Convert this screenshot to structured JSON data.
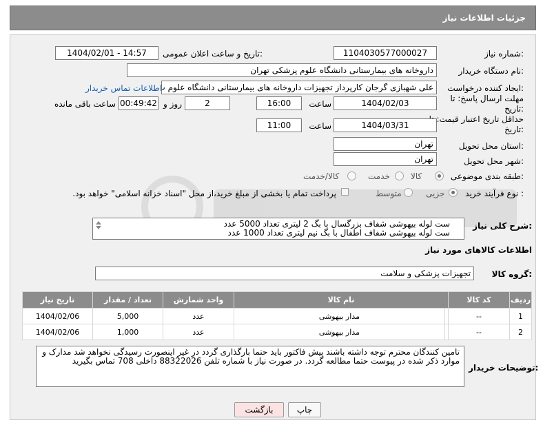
{
  "header": {
    "title": "جزئیات اطلاعات نیاز"
  },
  "fields": {
    "need_number_label": "شماره نیاز:",
    "need_number": "1104030577000027",
    "announce_label": "تاریخ و ساعت اعلان عمومی:",
    "announce_value": "1404/02/01 - 14:57",
    "buyer_org_label": "نام دستگاه خریدار:",
    "buyer_org": "داروخانه های بیمارستانی دانشگاه علوم پزشکی تهران",
    "creator_label": "ایجاد کننده درخواست:",
    "creator": "علی شهبازی گرجان کارپرداز تجهیزات داروخانه های بیمارستانی دانشگاه علوم پ",
    "contact_link": "اطلاعات تماس خریدار",
    "reply_deadline_label": "مهلت ارسال پاسخ: تا تاریخ:",
    "reply_date": "1404/02/03",
    "time_label": "ساعت",
    "reply_time": "16:00",
    "days_value": "2",
    "days_label": "روز و",
    "remaining_value": "00:49:42",
    "remaining_label": "ساعت باقی مانده",
    "price_validity_label": "حداقل تاریخ اعتبار قیمت: تا تاریخ:",
    "validity_date": "1404/03/31",
    "validity_time": "11:00",
    "province_label": "استان محل تحویل:",
    "province": "تهران",
    "city_label": "شهر محل تحویل:",
    "city": "تهران",
    "category_label": "طبقه بندی موضوعی:",
    "category_options": [
      "کالا",
      "خدمت",
      "کالا/خدمت"
    ],
    "process_label": "نوع فرآیند خرید :",
    "process_options": [
      "جزیی",
      "متوسط"
    ],
    "payment_note": "پرداخت تمام یا بخشی از مبلغ خرید،از محل \"اسناد خزانه اسلامی\" خواهد بود."
  },
  "description": {
    "label": "شرح کلی نیاز:",
    "lines": [
      "ست لوله بیهوشی شفاف بزرگسال با بگ 2 لیتری تعداد 5000 عدد",
      "ست لوله بیهوشی شفاف اطفال با بگ نیم لیتری تعداد 1000 عدد"
    ]
  },
  "goods": {
    "section_title": "اطلاعات کالاهای مورد نیاز",
    "group_label": "گروه کالا:",
    "group_value": "تجهیزات پزشکی و سلامت",
    "columns": [
      "ردیف",
      "کد کالا",
      "نام کالا",
      "واحد شمارش",
      "تعداد / مقدار",
      "تاریخ نیاز"
    ],
    "rows": [
      {
        "row": "1",
        "code": "--",
        "name": "مدار بیهوشی",
        "unit": "عدد",
        "qty": "5,000",
        "date": "1404/02/06"
      },
      {
        "row": "2",
        "code": "--",
        "name": "مدار بیهوشی",
        "unit": "عدد",
        "qty": "1,000",
        "date": "1404/02/06"
      }
    ]
  },
  "buyer_notes": {
    "label": "توضیحات خریدار:",
    "text": "تامین کنندگان محترم توجه داشته باشند پیش فاکتور باید حتما بارگذاری گردد در غیر اینصورت رسیدگی نخواهد شد مدارک و موارد ذکر شده در پیوست حتما مطالعه گردد. در صورت نیاز با شماره تلفن 88322026 داخلی 708 تماس بگیرید"
  },
  "buttons": {
    "back": "بازگشت",
    "print": "چاپ"
  },
  "colors": {
    "header_bg": "#8c8c8c",
    "panel_bg": "#f0f0f0",
    "link": "#1b5fb0",
    "back_button_bg": "#fbe3e3"
  }
}
